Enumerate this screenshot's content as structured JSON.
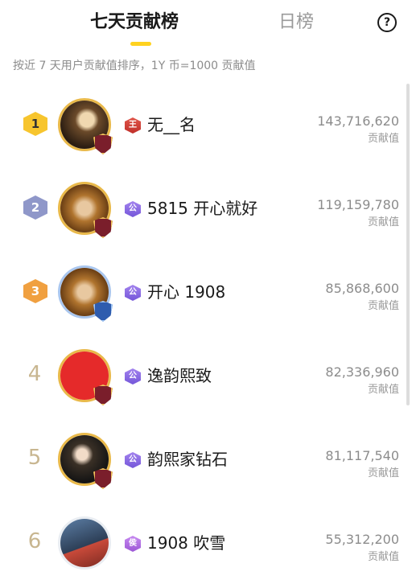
{
  "tabs": [
    {
      "label": "七天贡献榜",
      "active": true
    },
    {
      "label": "日榜",
      "active": false
    }
  ],
  "help_label": "?",
  "description": "按近 7 天用户贡献值排序，1Y 币=1000 贡献值",
  "unit_label": "贡献值",
  "rows": [
    {
      "rank": "1",
      "name": "无__名",
      "role": "王",
      "value": "143,716,620"
    },
    {
      "rank": "2",
      "name": "5815 开心就好",
      "role": "公",
      "value": "119,159,780"
    },
    {
      "rank": "3",
      "name": "开心 1908",
      "role": "公",
      "value": "85,868,600"
    },
    {
      "rank": "4",
      "name": "逸韵熙致",
      "role": "公",
      "value": "82,336,960"
    },
    {
      "rank": "5",
      "name": "韵熙家钻石",
      "role": "公",
      "value": "81,117,540"
    },
    {
      "rank": "6",
      "name": "1908 吹雪",
      "role": "侯",
      "value": "55,312,200"
    }
  ],
  "colors": {
    "accent": "#ffd21f",
    "gold_badge": "#f7c52e",
    "silver_badge": "#8f97c9",
    "bronze_badge": "#f0a040",
    "plain_rank": "#c8b690"
  }
}
